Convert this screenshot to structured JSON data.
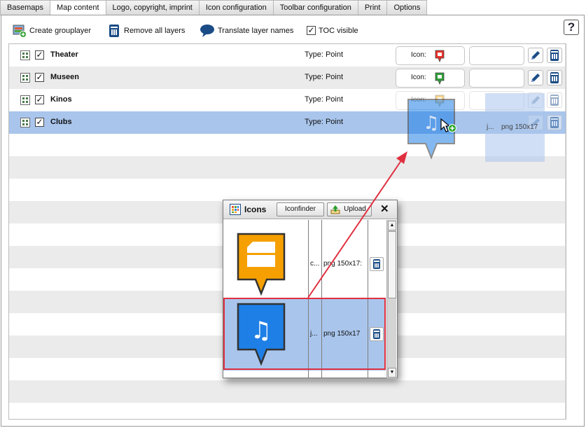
{
  "tabs": [
    {
      "label": "Basemaps",
      "active": false
    },
    {
      "label": "Map content",
      "active": true
    },
    {
      "label": "Logo, copyright, imprint",
      "active": false
    },
    {
      "label": "Icon configuration",
      "active": false
    },
    {
      "label": "Toolbar configuration",
      "active": false
    },
    {
      "label": "Print",
      "active": false
    },
    {
      "label": "Options",
      "active": false
    }
  ],
  "toolbar": {
    "create_grouplayer": "Create grouplayer",
    "remove_all_layers": "Remove all layers",
    "translate_layer_names": "Translate layer names",
    "toc_visible": "TOC visible",
    "toc_visible_checked": true,
    "help": "?"
  },
  "layers": [
    {
      "name": "Theater",
      "type": "Type: Point",
      "icon_label": "Icon:",
      "icon_color": "#e8302a",
      "checked": true,
      "selected": false
    },
    {
      "name": "Museen",
      "type": "Type: Point",
      "icon_label": "Icon:",
      "icon_color": "#2f9e3a",
      "checked": true,
      "selected": false
    },
    {
      "name": "Kinos",
      "type": "Type: Point",
      "icon_label": "Icon:",
      "icon_color": "#f5a000",
      "checked": true,
      "selected": false
    },
    {
      "name": "Clubs",
      "type": "Type: Point",
      "icon_label": "Icon:",
      "icon_color": "#1e7fe6",
      "checked": true,
      "selected": true
    }
  ],
  "drag_ghost": {
    "file_abbrev": "j...",
    "size_text": "png 150x17"
  },
  "icons_dialog": {
    "title": "Icons",
    "iconfinder_label": "Iconfinder",
    "upload_label": "Upload",
    "close": "✕",
    "rows": [
      {
        "name_abbrev": "c...",
        "info": "png 150x17:",
        "color": "#f5a000",
        "selected": false
      },
      {
        "name_abbrev": "j...",
        "info": "png 150x17",
        "color": "#1e7fe6",
        "selected": true
      }
    ]
  },
  "colors": {
    "selection": "#a9c5ec",
    "highlight_red": "#e03040",
    "accent_blue": "#1a4f8a"
  }
}
